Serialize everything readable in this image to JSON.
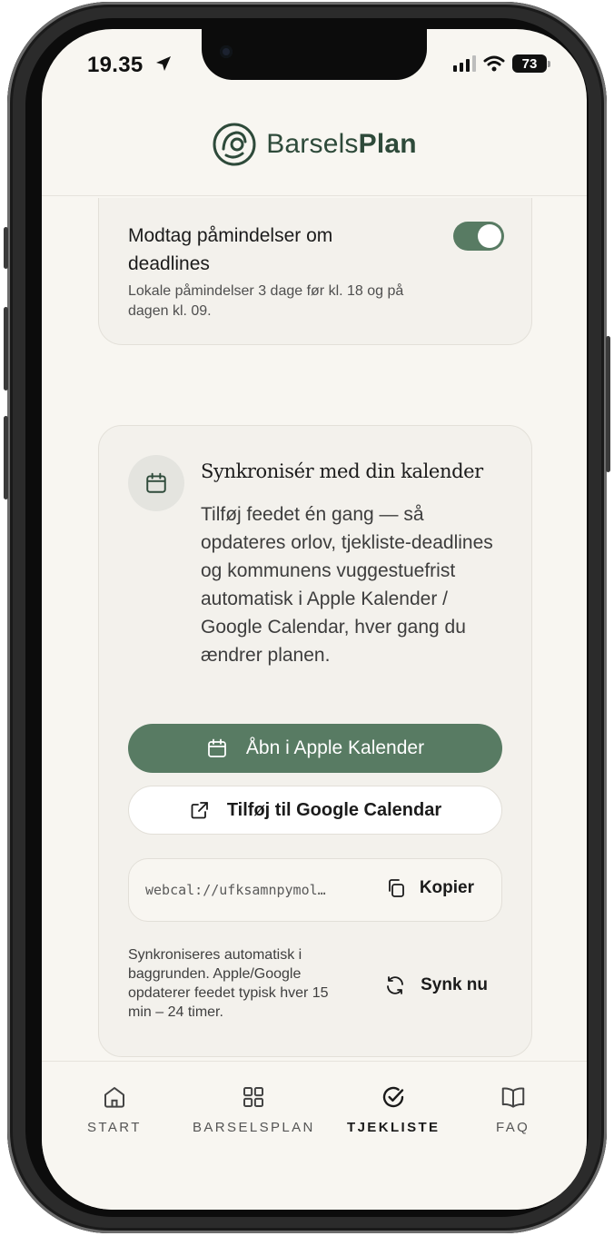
{
  "status_bar": {
    "time": "19.35",
    "battery": "73"
  },
  "header": {
    "brand_regular": "Barsels",
    "brand_bold": "Plan"
  },
  "reminder_card": {
    "title": "Modtag påmindelser om deadlines",
    "subtitle": "Lokale påmindelser 3 dage før kl. 18 og på dagen kl. 09.",
    "toggle_on": true
  },
  "sync_card": {
    "title": "Synkronisér med din kalender",
    "description": "Tilføj feedet én gang — så opdateres orlov, tjekliste-deadlines og kommunens vuggestuefrist automatisk i Apple Kalender / Google Calendar, hver gang du ændrer planen.",
    "apple_button": "Åbn i Apple Kalender",
    "google_button": "Tilføj til Google Calendar",
    "feed_url": "webcal://ufksamnpymol…",
    "copy_label": "Kopier",
    "note": "Synkroniseres automatisk i baggrunden. Apple/Google opdaterer feedet typisk hver 15 min – 24 timer.",
    "sync_now_label": "Synk nu"
  },
  "nav": {
    "items": [
      {
        "label": "START",
        "icon": "home-icon"
      },
      {
        "label": "BARSELSPLAN",
        "icon": "grid-icon"
      },
      {
        "label": "TJEKLISTE",
        "icon": "check-circle-icon",
        "active": true
      },
      {
        "label": "FAQ",
        "icon": "book-icon"
      }
    ]
  },
  "colors": {
    "accent": "#587b63",
    "background": "#f8f6f1",
    "card": "#f3f1ec",
    "brand": "#2e4a3a"
  }
}
